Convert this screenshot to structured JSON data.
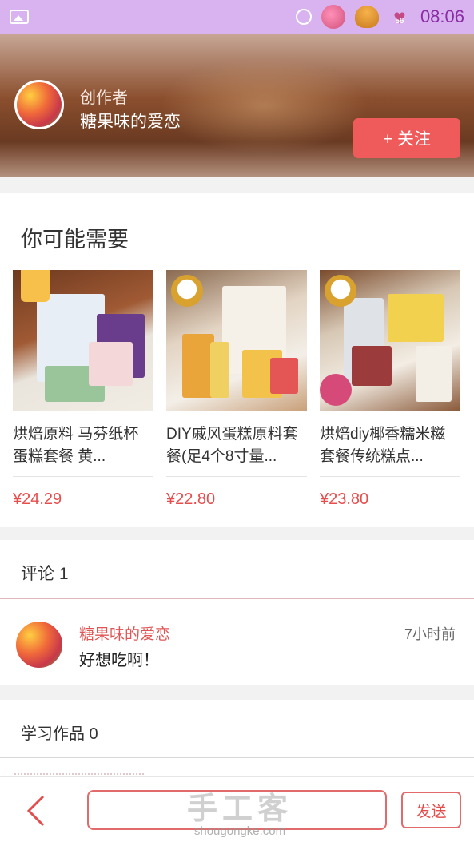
{
  "status_bar": {
    "time": "08:06",
    "battery": "56",
    "icons": [
      "image-icon",
      "alarm-icon",
      "flower-icon",
      "mushroom-icon",
      "heart-battery-icon"
    ]
  },
  "creator": {
    "label": "创作者",
    "name": "糖果味的爱恋",
    "follow_label": "+ 关注"
  },
  "recommend": {
    "title": "你可能需要",
    "products": [
      {
        "title": "烘焙原料  马芬纸杯蛋糕套餐  黄...",
        "price": "¥24.29"
      },
      {
        "title": "DIY戚风蛋糕原料套餐(足4个8寸量...",
        "price": "¥22.80"
      },
      {
        "title": "烘焙diy椰香糯米糍套餐传统糕点...",
        "price": "¥23.80"
      }
    ]
  },
  "comments": {
    "title": "评论 1",
    "items": [
      {
        "author": "糖果味的爱恋",
        "time": "7小时前",
        "text": "好想吃啊！"
      }
    ]
  },
  "works": {
    "title": "学习作品 0"
  },
  "bottom_bar": {
    "input_value": "",
    "send_label": "发送"
  },
  "watermark": {
    "main": "手工客",
    "sub": "shougongke.com"
  },
  "colors": {
    "status_bar": "#d9b3ef",
    "accent": "#ef5b5b",
    "price": "#e84d4d"
  }
}
